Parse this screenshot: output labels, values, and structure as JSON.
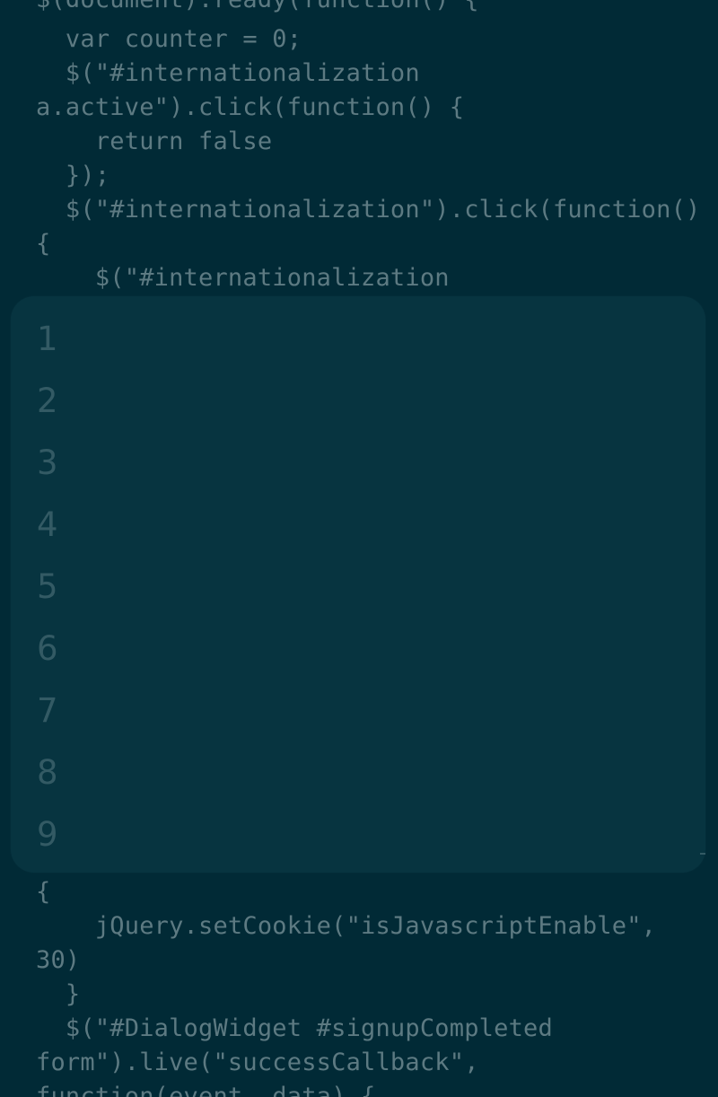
{
  "code": {
    "lines": [
      "$(document).ready(function() {",
      "  var counter = 0;",
      "  $(\"#internationalization",
      "a.active\").click(function() {",
      "    return false",
      "  });",
      "  $(\"#internationalization\").click(function()",
      "{",
      "    $(\"#internationalization",
      "{",
      "    jQuery.setCookie(\"isJavascriptEnable\",",
      "30)",
      "  }",
      "  $(\"#DialogWidget #signupCompleted",
      "form\").live(\"successCallback\",",
      "function(event, data) {"
    ]
  },
  "overlay": {
    "line_numbers": [
      "1",
      "2",
      "3",
      "4",
      "5",
      "6",
      "7",
      "8",
      "9"
    ]
  }
}
